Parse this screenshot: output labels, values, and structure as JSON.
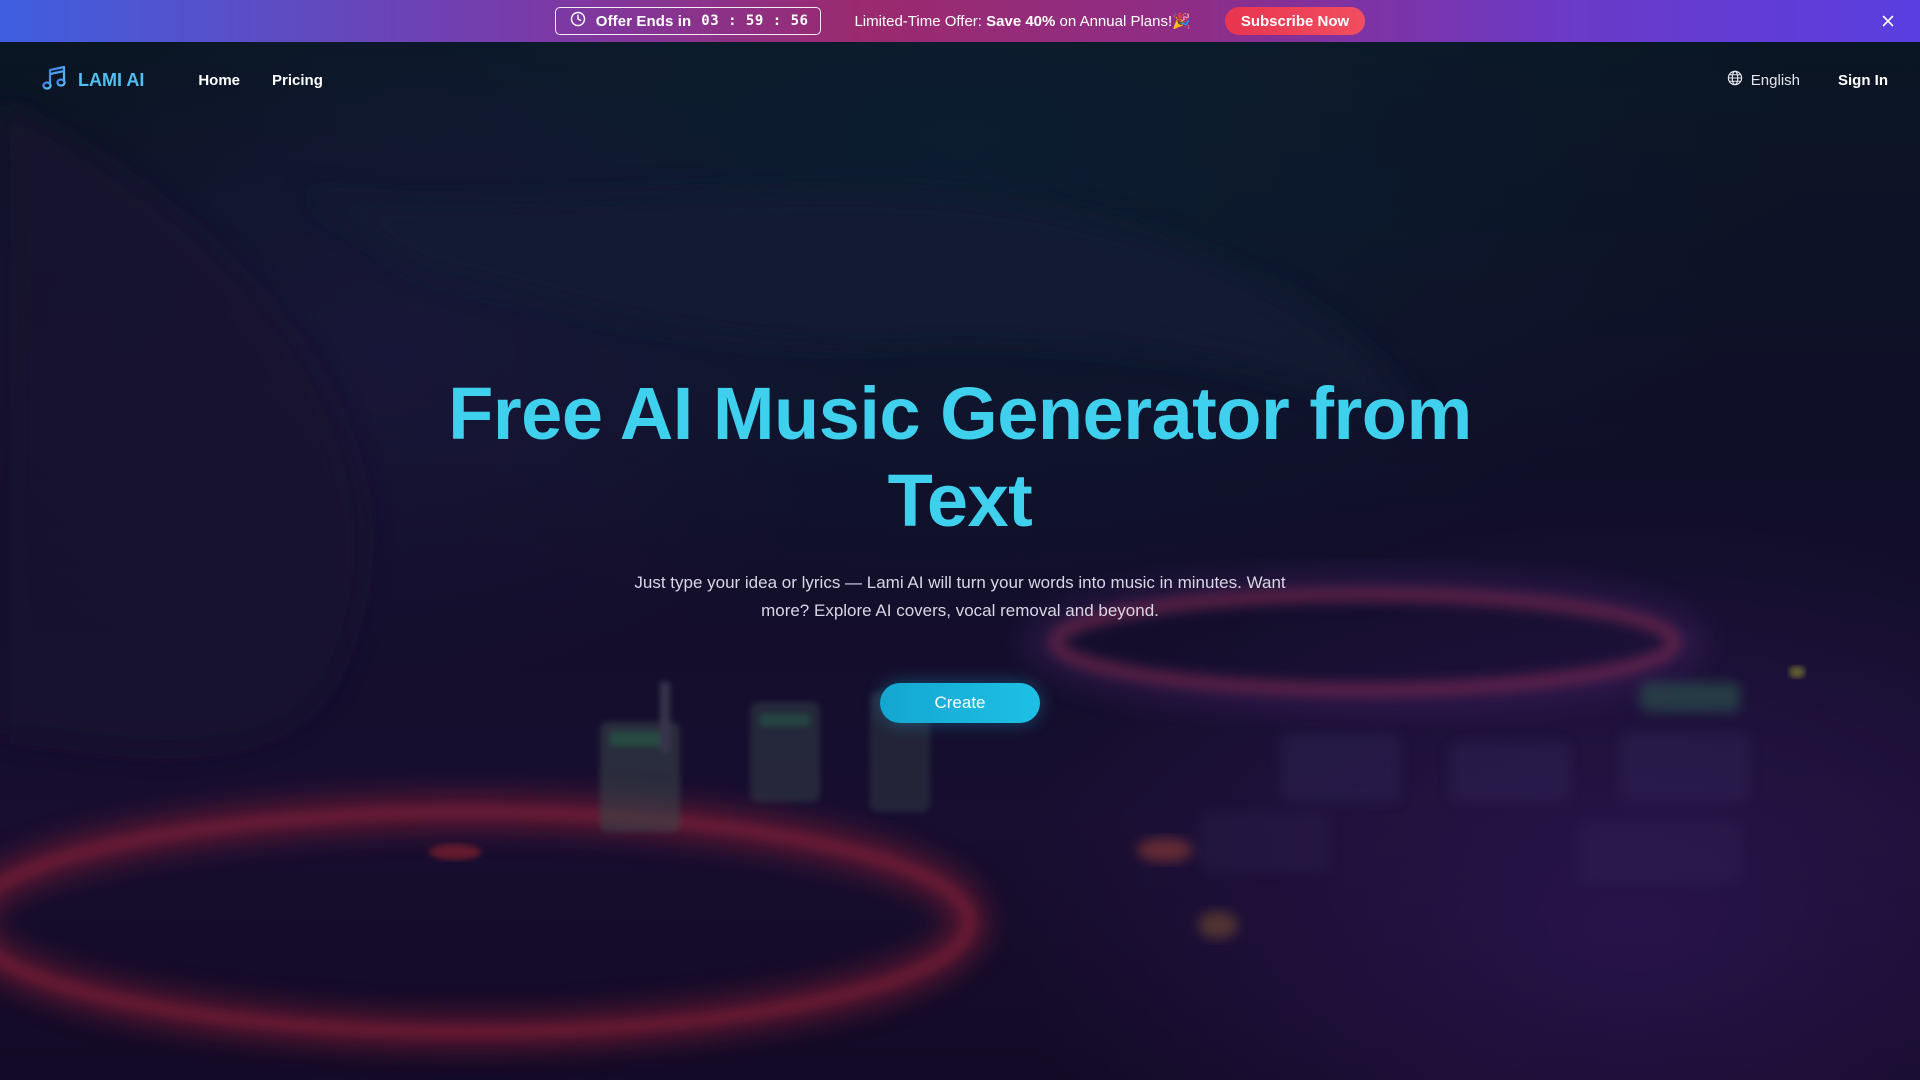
{
  "promo": {
    "countdown_label": "Offer Ends in",
    "countdown_value": "03 : 59 : 56",
    "offer_prefix": "Limited-Time Offer: ",
    "offer_bold": "Save 40%",
    "offer_suffix": " on Annual Plans!",
    "offer_emoji": "🎉",
    "subscribe_label": "Subscribe Now",
    "close_icon": "close-icon"
  },
  "nav": {
    "brand": "LAMI AI",
    "brand_icon": "music-note-icon",
    "links": [
      {
        "label": "Home"
      },
      {
        "label": "Pricing"
      }
    ],
    "language": "English",
    "language_icon": "globe-icon",
    "sign_in": "Sign In"
  },
  "hero": {
    "title": "Free AI Music Generator from Text",
    "subtitle": "Just type your idea or lyrics — Lami AI will turn your words into music in minutes. Want more? Explore AI covers, vocal removal and beyond.",
    "cta_label": "Create"
  },
  "colors": {
    "brand": "#4fc0f0",
    "title": "#3fd0ee",
    "cta": "#1ab4dc",
    "subscribe": "#ea3a52"
  }
}
